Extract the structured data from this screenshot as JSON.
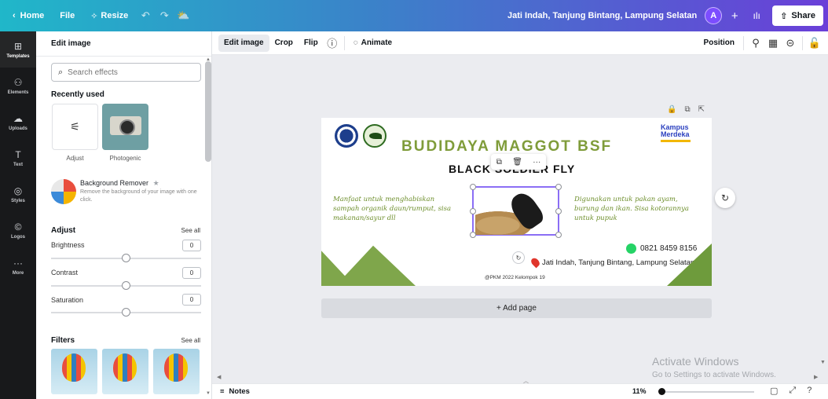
{
  "topbar": {
    "home": "Home",
    "file": "File",
    "resize": "Resize",
    "undo_icon": "↶",
    "redo_icon": "↷",
    "cloud_icon": "⛅",
    "title": "Jati Indah, Tanjung Bintang, Lampung Selatan",
    "avatar": "A",
    "plus": "+",
    "chart_icon": "ılı",
    "share": "Share"
  },
  "rail": [
    {
      "label": "Templates",
      "glyph": "⊞"
    },
    {
      "label": "Elements",
      "glyph": "⚇"
    },
    {
      "label": "Uploads",
      "glyph": "☁"
    },
    {
      "label": "Text",
      "glyph": "T"
    },
    {
      "label": "Styles",
      "glyph": "◎"
    },
    {
      "label": "Logos",
      "glyph": "©"
    },
    {
      "label": "More",
      "glyph": "···"
    }
  ],
  "panel": {
    "header": "Edit image",
    "search_placeholder": "Search effects",
    "recently_used": "Recently used",
    "adjust_label": "Adjust",
    "adjust_glyph": "⚟",
    "photogenic_label": "Photogenic",
    "bg_remover_title": "Background Remover",
    "bg_remover_star": "★",
    "bg_remover_desc": "Remove the background of your image with one click.",
    "adjust_title": "Adjust",
    "see_all": "See all",
    "sliders": [
      {
        "label": "Brightness",
        "value": "0"
      },
      {
        "label": "Contrast",
        "value": "0"
      },
      {
        "label": "Saturation",
        "value": "0"
      }
    ],
    "filters_title": "Filters",
    "filters_see_all": "See all"
  },
  "toolbar": {
    "edit_image": "Edit image",
    "crop": "Crop",
    "flip": "Flip",
    "info_icon": "ⓘ",
    "animate": "Animate",
    "position": "Position",
    "paint_icon": "⚲",
    "transparency_icon": "▦",
    "link_icon": "⊝",
    "lock_icon": "🔓"
  },
  "canvas": {
    "page_lock_icon": "🔒",
    "page_copy_icon": "⧉",
    "page_add_icon": "⇱",
    "kampus_line1": "Kampus",
    "kampus_line2": "Merdeka",
    "title_main": "BUDIDAYA MAGGOT BSF",
    "title_sub": "BLACK SOLDIER FLY",
    "float_copy": "⧉",
    "float_trash": "🗑",
    "float_more": "···",
    "caption_left": "Manfaat untuk menghabiskan sampah organik daun/rumput, sisa makanan/sayur dll",
    "caption_right": "Digunakan untuk pakan ayam, burung dan ikan. Sisa kotorannya untuk pupuk",
    "rotate_icon": "↻",
    "phone": "0821 8459 8156",
    "address": "Jati Indah, Tanjung Bintang, Lampung Selatan",
    "copyright": "@PKM 2022 Kelompok 19",
    "refresh_icon": "↻",
    "add_page": "+ Add page",
    "watermark_title": "Activate Windows",
    "watermark_sub": "Go to Settings to activate Windows."
  },
  "bottombar": {
    "notes_icon": "≡",
    "notes": "Notes",
    "zoom": "11%",
    "zoom_level_percent": 11,
    "pages_icon": "▢",
    "fullscreen_icon": "⤢",
    "help_icon": "?"
  }
}
